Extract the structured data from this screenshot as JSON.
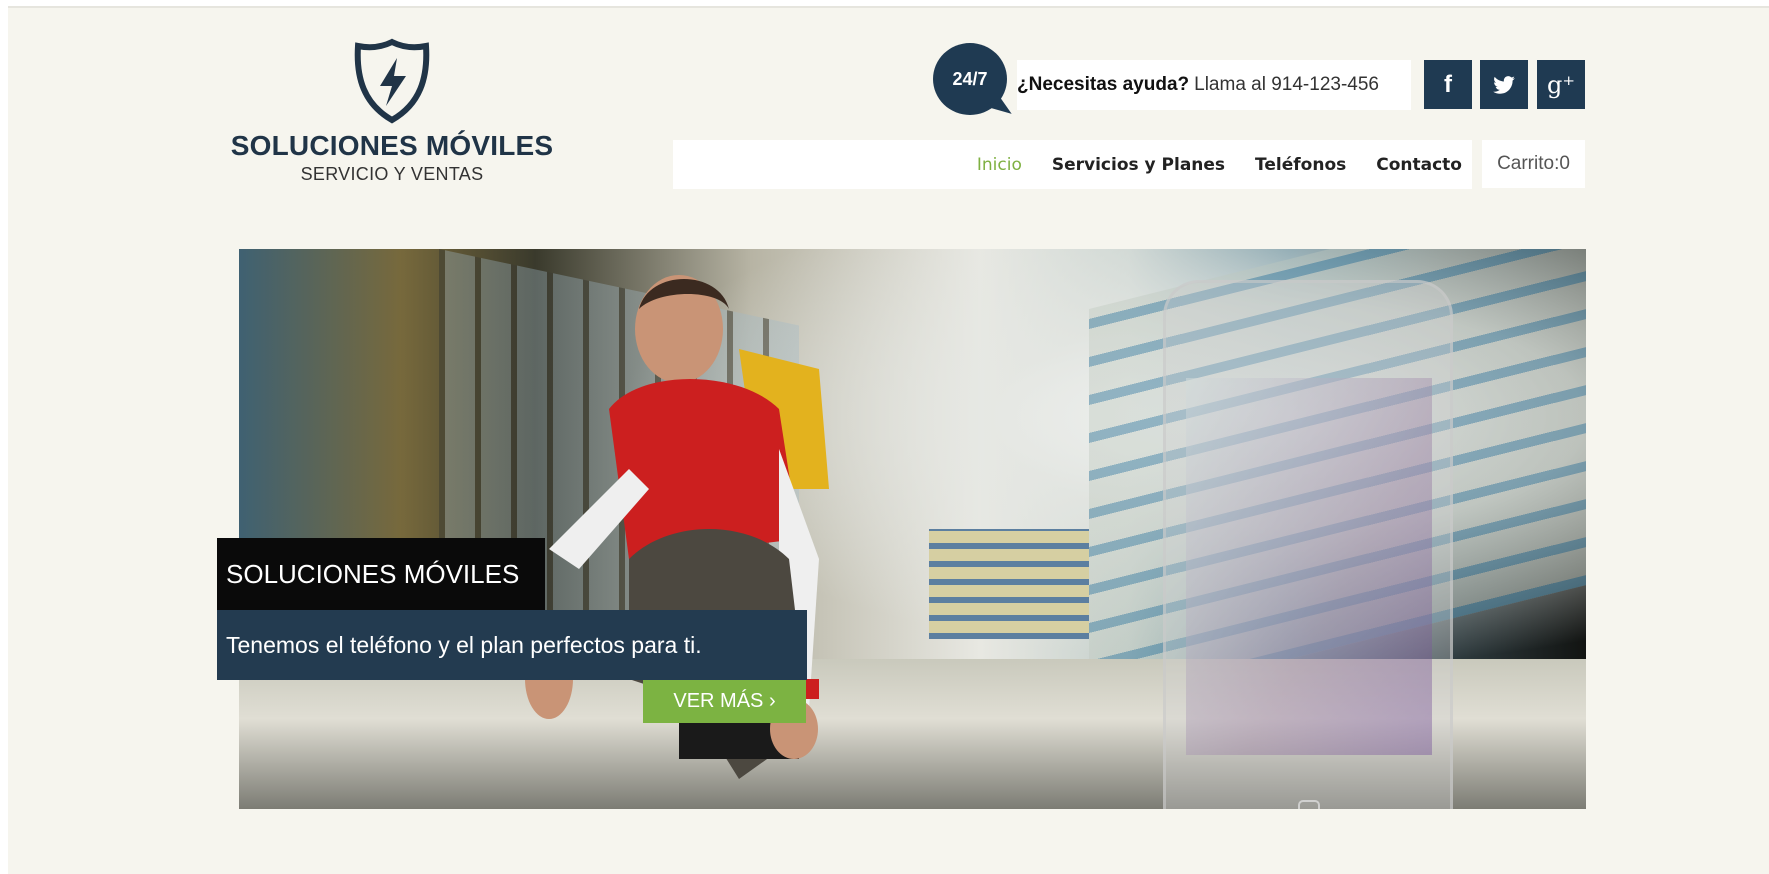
{
  "brand": {
    "title": "SOLUCIONES MÓVILES",
    "subtitle": "SERVICIO Y VENTAS",
    "icon": "shield-lightning-icon"
  },
  "support": {
    "badge": "24/7",
    "question": "¿Necesitas ayuda?",
    "phone_text": "Llama al 914-123-456"
  },
  "social": {
    "facebook_glyph": "f",
    "twitter_glyph": "✓",
    "googleplus_glyph": "g⁺"
  },
  "nav": {
    "items": [
      "Inicio",
      "Servicios y Planes",
      "Teléfonos",
      "Contacto"
    ],
    "active": "Inicio"
  },
  "cart": {
    "label": "Carrito:0"
  },
  "hero": {
    "title": "SOLUCIONES MÓVILES",
    "text": "Tenemos el teléfono y el plan perfectos para ti.",
    "button": "VER MÁS ›"
  },
  "colors": {
    "navy": "#1f3a52",
    "accent_green": "#7cb342",
    "background": "#f6f5ee"
  }
}
